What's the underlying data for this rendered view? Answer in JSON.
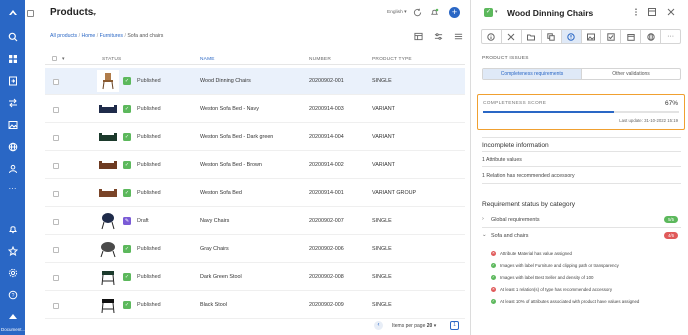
{
  "rail": {
    "items": [
      "logo",
      "search",
      "grid",
      "export",
      "transfer",
      "image",
      "globe",
      "users",
      "more",
      "bell",
      "star",
      "settings",
      "help"
    ],
    "bottom_label": "Document..."
  },
  "header": {
    "title": "Products",
    "language": "English",
    "breadcrumb": [
      "All products",
      "Home",
      "Furnitures",
      "Sofa and chairs"
    ]
  },
  "table": {
    "columns": {
      "status": "STATUS",
      "name": "NAME",
      "number": "NUMBER",
      "product_type": "PRODUCT TYPE"
    },
    "rows": [
      {
        "status": "Published",
        "name": "Wood Dinning Chairs",
        "number": "20200902-001",
        "type": "SINGLE",
        "selected": true,
        "thumb": "chair"
      },
      {
        "status": "Published",
        "name": "Weston Sofa Bed - Navy",
        "number": "20200914-003",
        "type": "VARIANT",
        "thumb": "sofa-navy"
      },
      {
        "status": "Published",
        "name": "Weston Sofa Bed - Dark green",
        "number": "20200914-004",
        "type": "VARIANT",
        "thumb": "sofa-green"
      },
      {
        "status": "Published",
        "name": "Weston Sofa Bed - Brown",
        "number": "20200914-002",
        "type": "VARIANT",
        "thumb": "sofa-brown"
      },
      {
        "status": "Published",
        "name": "Weston Sofa Bed",
        "number": "20200914-001",
        "type": "VARIANT GROUP",
        "thumb": "sofa-brown"
      },
      {
        "status": "Draft",
        "name": "Navy Chairs",
        "number": "20200902-007",
        "type": "SINGLE",
        "thumb": "navy-chair"
      },
      {
        "status": "Published",
        "name": "Gray Chairs",
        "number": "20200902-006",
        "type": "SINGLE",
        "thumb": "gray-chair"
      },
      {
        "status": "Published",
        "name": "Dark Green Stool",
        "number": "20200902-008",
        "type": "SINGLE",
        "thumb": "green-stool"
      },
      {
        "status": "Published",
        "name": "Black Stool",
        "number": "20200902-009",
        "type": "SINGLE",
        "thumb": "black-stool"
      }
    ]
  },
  "footer": {
    "items_per_page_label": "Items per page",
    "items_per_page": "20",
    "page": "1"
  },
  "panel": {
    "title": "Wood Dinning Chairs",
    "section_label": "PRODUCT ISSUES",
    "segments": [
      "Completeness requirements",
      "Other validations"
    ],
    "score_label": "COMPLETENESS SCORE",
    "score_value": "67%",
    "score_fraction": 0.67,
    "last_update": "Last update: 31-10-2022 15:19",
    "incomplete_title": "Incomplete information",
    "incomplete_lines": [
      "1 Attribute values",
      "1 Relation has recommended accessory"
    ],
    "req_title": "Requirement status by category",
    "categories": [
      {
        "name": "Global requirements",
        "pill": "5/5",
        "state": "green",
        "chev": "›"
      },
      {
        "name": "Sofa and chairs",
        "pill": "4/6",
        "state": "red",
        "chev": "⌄"
      }
    ],
    "requirements": [
      {
        "ok": false,
        "text": "Attribute Material has value assigned"
      },
      {
        "ok": true,
        "text": "Images with label Furniture and clipping path or transparency"
      },
      {
        "ok": true,
        "text": "Images with label Best Seller and density of 100"
      },
      {
        "ok": false,
        "text": "At least 1 relation(s) of type has recommended accessory"
      },
      {
        "ok": true,
        "text": "At least 10% of attributes associated with product have values assigned"
      }
    ]
  },
  "colors": {
    "rail": "#2a67c5",
    "published": "#5cb85c",
    "draft": "#7a5bd6",
    "highlight": "#f0a030"
  }
}
